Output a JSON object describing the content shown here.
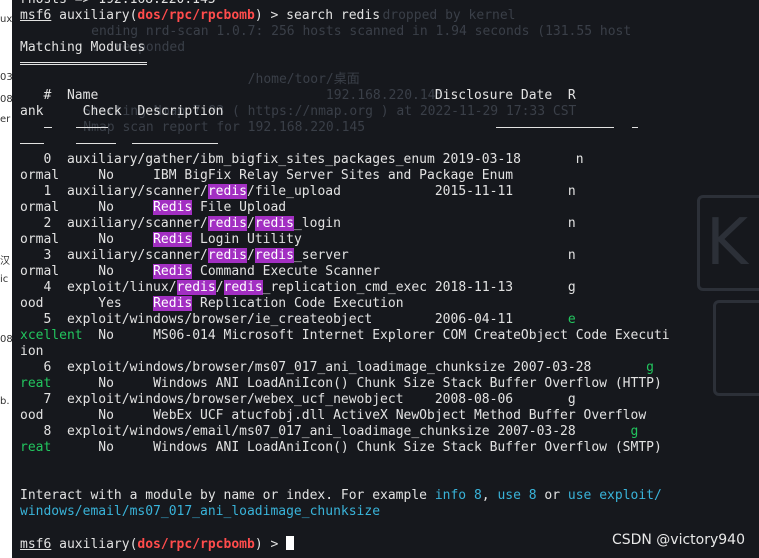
{
  "left_strip": [
    "ux",
    "03",
    "08",
    "er",
    "汉",
    "ic",
    "08",
    "b."
  ],
  "ghost_lines": [
    "                                dropped by kernel",
    "     ending nrd-scan 1.0.7: 256 hosts scanned in 1.94 seconds (131.55 host",
    "     ...responded",
    "                         /home/toor/桌面",
    "                                   192.168.220.145",
    "    Starting Nmap 7.93 ( https://nmap.org ) at 2022-11-29 17:33 CST",
    "    Nmap scan report for 192.168.220.145"
  ],
  "watermark": "CSDN @victory940",
  "terminal": {
    "top_partial": "rhosts => 192.168.220.145",
    "prompt1": {
      "user": "msf6",
      "text_a": " auxiliary(",
      "module": "dos/rpc/rpcbomb",
      "text_b": ") > search redis"
    },
    "matching_title": "Matching Modules",
    "header1": "   #  Name                                           Disclosure Date  R",
    "header2": "ank     Check  Description",
    "results": [
      {
        "num": "0",
        "path": "auxiliary/gather/ibm_bigfix_sites_packages_enum",
        "date": "2019-03-18",
        "r": "n",
        "rank_rest": "ormal",
        "check": "No",
        "desc": [
          {
            "t": "IBM BigFix Relay Server Sites and Package Enum"
          }
        ]
      },
      {
        "num": "1",
        "path_parts": [
          {
            "t": "auxiliary/scanner/"
          },
          {
            "t": "redis",
            "hl": true
          },
          {
            "t": "/file_upload"
          }
        ],
        "date": "2015-11-11",
        "r": "n",
        "rank_rest": "ormal",
        "check": "No",
        "desc": [
          {
            "t": "Redis",
            "hl": true
          },
          {
            "t": " File Upload"
          }
        ]
      },
      {
        "num": "2",
        "path_parts": [
          {
            "t": "auxiliary/scanner/"
          },
          {
            "t": "redis",
            "hl": true
          },
          {
            "t": "/"
          },
          {
            "t": "redis",
            "hl": true
          },
          {
            "t": "_login"
          }
        ],
        "date": "",
        "r": "n",
        "rank_rest": "ormal",
        "check": "No",
        "desc": [
          {
            "t": "Redis",
            "hl": true
          },
          {
            "t": " Login Utility"
          }
        ]
      },
      {
        "num": "3",
        "path_parts": [
          {
            "t": "auxiliary/scanner/"
          },
          {
            "t": "redis",
            "hl": true
          },
          {
            "t": "/"
          },
          {
            "t": "redis",
            "hl": true
          },
          {
            "t": "_server"
          }
        ],
        "date": "",
        "r": "n",
        "rank_rest": "ormal",
        "check": "No",
        "desc": [
          {
            "t": "Redis",
            "hl": true
          },
          {
            "t": " Command Execute Scanner"
          }
        ]
      },
      {
        "num": "4",
        "path_parts": [
          {
            "t": "exploit/linux/"
          },
          {
            "t": "redis",
            "hl": true
          },
          {
            "t": "/"
          },
          {
            "t": "redis",
            "hl": true
          },
          {
            "t": "_replication_cmd_exec"
          }
        ],
        "date": "2018-11-13",
        "r": "g",
        "rank_rest": "ood",
        "check": "Yes",
        "desc": [
          {
            "t": "Redis",
            "hl": true
          },
          {
            "t": " Replication Code Execution"
          }
        ]
      },
      {
        "num": "5",
        "path": "exploit/windows/browser/ie_createobject",
        "date": "2006-04-11",
        "r": "e",
        "r_green": true,
        "rank_rest": "xcellent",
        "rank_green": true,
        "check": "No",
        "desc": [
          {
            "t": "MS06-014 Microsoft Internet Explorer COM CreateObject Code Executi"
          }
        ],
        "desc_wrap": "ion"
      },
      {
        "num": "6",
        "path": "exploit/windows/browser/ms07_017_ani_loadimage_chunksize",
        "date": "2007-03-28",
        "r": "g",
        "r_green": true,
        "rank_rest": "reat",
        "rank_green": true,
        "check": "No",
        "desc": [
          {
            "t": "Windows ANI LoadAniIcon() Chunk Size Stack Buffer Overflow (HTTP)"
          }
        ]
      },
      {
        "num": "7",
        "path": "exploit/windows/browser/webex_ucf_newobject",
        "date": "2008-08-06",
        "r": "g",
        "rank_rest": "ood",
        "check": "No",
        "desc": [
          {
            "t": "WebEx UCF atucfobj.dll ActiveX NewObject Method Buffer Overflow"
          }
        ]
      },
      {
        "num": "8",
        "path": "exploit/windows/email/ms07_017_ani_loadimage_chunksize",
        "date": "2007-03-28",
        "r": "g",
        "r_green": true,
        "rank_rest": "reat",
        "rank_green": true,
        "check": "No",
        "desc": [
          {
            "t": "Windows ANI LoadAniIcon() Chunk Size Stack Buffer Overflow (SMTP)"
          }
        ]
      }
    ],
    "interact": {
      "a": "Interact with a module by name or index. For example ",
      "b": "info 8",
      "c": ", ",
      "d": "use 8",
      "e": " or ",
      "f": "use exploit/",
      "g": "windows/email/ms07_017_ani_loadimage_chunksize"
    },
    "prompt2": {
      "user": "msf6",
      "text_a": " auxiliary(",
      "module": "dos/rpc/rpcbomb",
      "text_b": ") > "
    }
  },
  "colors": {
    "background": "#16181d",
    "text": "#e2e2e2",
    "module": "#ff4c4c",
    "highlight": "#a22fc2",
    "link": "#39b3d9",
    "rank_great": "#22c55e"
  }
}
